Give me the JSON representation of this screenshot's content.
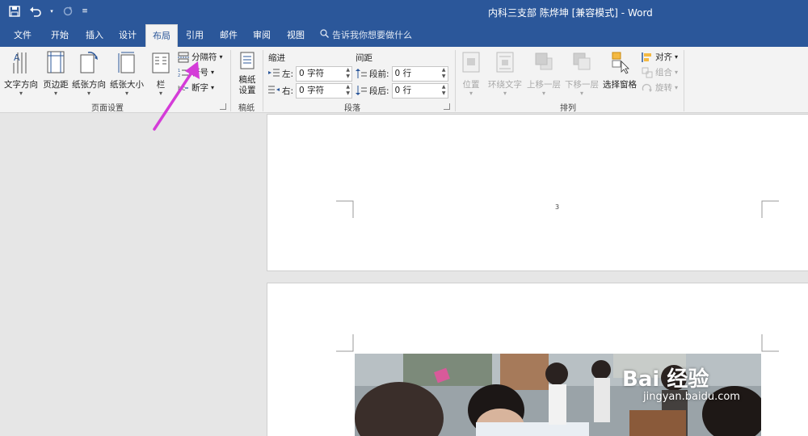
{
  "titlebar": {
    "title": "内科三支部 陈烨坤 [兼容模式]  -  Word"
  },
  "tabs": [
    "文件",
    "开始",
    "插入",
    "设计",
    "布局",
    "引用",
    "邮件",
    "审阅",
    "视图"
  ],
  "active_tab": "布局",
  "tell_me": "告诉我你想要做什么",
  "page_setup": {
    "text_direction": "文字方向",
    "margins": "页边距",
    "orientation": "纸张方向",
    "size": "纸张大小",
    "columns": "栏",
    "breaks": "分隔符",
    "line_numbers": "行号",
    "hyphenation": "断字",
    "group_label": "页面设置"
  },
  "manuscript": {
    "button": "稿纸\n设置",
    "group_label": "稿纸"
  },
  "paragraph": {
    "indent_head": "缩进",
    "spacing_head": "间距",
    "left_label": "左:",
    "left_value": "0 字符",
    "right_label": "右:",
    "right_value": "0 字符",
    "before_label": "段前:",
    "before_value": "0 行",
    "after_label": "段后:",
    "after_value": "0 行",
    "group_label": "段落"
  },
  "arrange": {
    "position": "位置",
    "wrap_text": "环绕文字",
    "bring_forward": "上移一层",
    "send_backward": "下移一层",
    "selection_pane": "选择窗格",
    "align": "对齐",
    "group": "组合",
    "rotate": "旋转",
    "group_label": "排列"
  },
  "document": {
    "page_number": "3"
  },
  "watermark": {
    "brand": "Bai 经验",
    "url": "jingyan.baidu.com"
  },
  "colors": {
    "accent": "#2b579a",
    "annotation_arrow": "#d43cd8"
  }
}
